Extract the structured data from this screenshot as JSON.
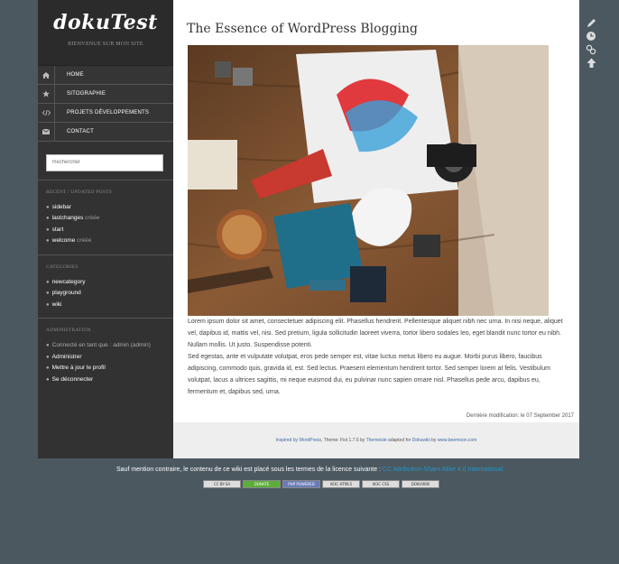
{
  "site": {
    "title": "dokuTest",
    "tagline": "BIENVENUE SUR MON SITE"
  },
  "menu": [
    {
      "label": "HOME",
      "icon": "home-icon"
    },
    {
      "label": "SITOGRAPHIE",
      "icon": "star-icon"
    },
    {
      "label": "PROJETS DÉVELOPPEMENTS",
      "icon": "code-icon"
    },
    {
      "label": "CONTACT",
      "icon": "envelope-icon"
    }
  ],
  "search": {
    "placeholder": "Rechercher"
  },
  "recent": {
    "title": "RECENT / UPDATED POSTS",
    "items": [
      {
        "label": "sidebar",
        "suffix": ""
      },
      {
        "label": "lastchanges",
        "suffix": "créée"
      },
      {
        "label": "start",
        "suffix": ""
      },
      {
        "label": "welcome",
        "suffix": "créée"
      }
    ]
  },
  "categories": {
    "title": "CATEGORIES",
    "items": [
      "newcategory",
      "playground",
      "wiki"
    ]
  },
  "administration": {
    "title": "ADMINISTRATION",
    "items": [
      "Connecté en tant que : admin (admin)",
      "Administrer",
      "Mettre à jour le profil",
      "Se déconnecter"
    ]
  },
  "post": {
    "title": "The Essence of WordPress Blogging",
    "paragraphs": [
      "Lorem ipsum dolor sit amet, consectetuer adipiscing elit. Phasellus hendrerit. Pellentesque aliquet nibh nec urna. In nisi neque, aliquet vel, dapibus id, mattis vel, nisi. Sed pretium, ligula sollicitudin laoreet viverra, tortor libero sodales leo, eget blandit nunc tortor eu nibh. Nullam mollis. Ut justo. Suspendisse potenti.",
      "Sed egestas, ante et vulputate volutpat, eros pede semper est, vitae luctus metus libero eu augue. Morbi purus libero, faucibus adipiscing, commodo quis, gravida id, est. Sed lectus. Praesent elementum hendrerit tortor. Sed semper lorem at felis. Vestibulum volutpat, lacus a ultrices sagittis, mi neque euismod dui, eu pulvinar nunc sapien ornare nisl. Phasellus pede arcu, dapibus eu, fermentum et, dapibus sed, urna."
    ],
    "last_modified": "Dernière modification: le 07 September 2017"
  },
  "footer": {
    "part1": "Inspired by WordPress",
    "part2": ", Theme: Fist 1.7.6 by ",
    "part3": "Themeisle",
    "part4": " adapted for ",
    "part5": "Dokuwiki",
    "part6": " by ",
    "part7": "www.beemoon.com"
  },
  "license": {
    "text": "Sauf mention contraire, le contenu de ce wiki est placé sous les termes de la licence suivante : ",
    "link": "CC Attribution-Share Alike 4.0 International"
  },
  "badges": [
    "CC BY-SA",
    "DONATE",
    "PHP POWERED",
    "W3C HTML5",
    "W3C CSS",
    "DOKUWIKI"
  ],
  "tools": [
    {
      "icon": "pencil-icon"
    },
    {
      "icon": "history-icon"
    },
    {
      "icon": "link-icon"
    },
    {
      "icon": "arrow-up-icon"
    }
  ]
}
